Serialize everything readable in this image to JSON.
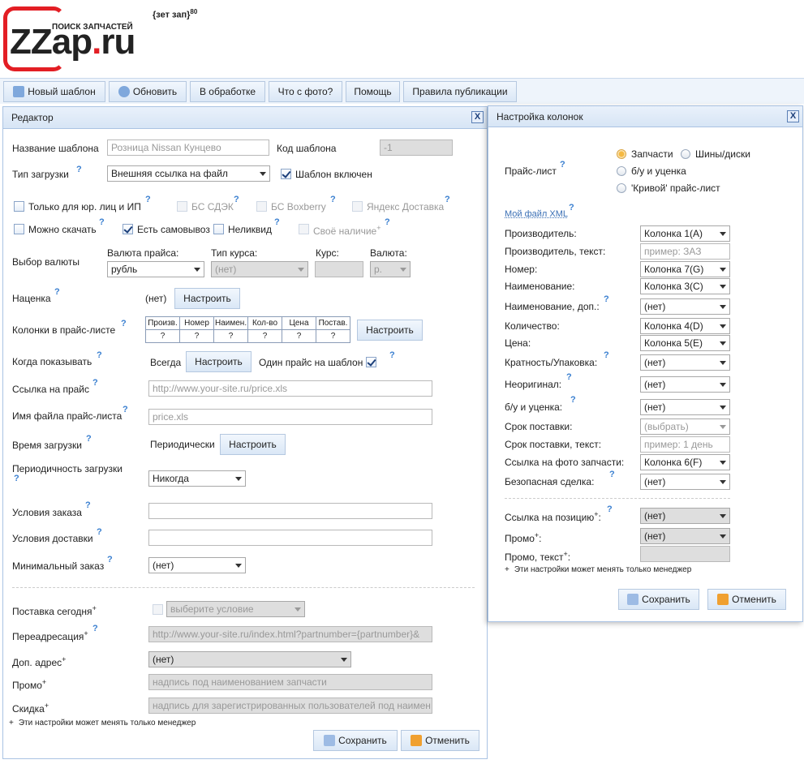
{
  "logo": {
    "main_z": "ZZ",
    "main_rest": "ap",
    "dot": ".",
    "domain": "ru",
    "tagline": "ПОИСК ЗАПЧАСТЕЙ",
    "badge": "{зет зап}",
    "badge_sup": "80"
  },
  "toolbar": {
    "new": "Новый шаблон",
    "refresh": "Обновить",
    "processing": "В обработке",
    "photo": "Что с фото?",
    "help": "Помощь",
    "rules": "Правила публикации"
  },
  "editor": {
    "title": "Редактор",
    "close": "X",
    "name_label": "Название шаблона",
    "name_placeholder": "Розница Nissan Кунцево",
    "code_label": "Код шаблона",
    "code_value": "-1",
    "load_type_label": "Тип загрузки",
    "load_type_value": "Внешняя ссылка на файл",
    "enabled_label": "Шаблон включен",
    "legal_only": "Только для юр. лиц и ИП",
    "cdek": "БС СДЭК",
    "boxberry": "БС Boxberry",
    "yandex": "Яндекс Доставка",
    "downloadable": "Можно скачать",
    "pickup": "Есть самовывоз",
    "illiquid": "Неликвид",
    "own_stock": "Своё наличие",
    "currency_label": "Выбор валюты",
    "price_currency_label": "Валюта прайса:",
    "price_currency_value": "рубль",
    "rate_type_label": "Тип курса:",
    "rate_type_value": "(нет)",
    "rate_label": "Курс:",
    "currency2_label": "Валюта:",
    "currency2_value": "р.",
    "markup_label": "Наценка",
    "markup_value": "(нет)",
    "setup": "Настроить",
    "columns_label": "Колонки в прайс-листе",
    "columns_headers": [
      "Произв.",
      "Номер",
      "Наимен.",
      "Кол-во",
      "Цена",
      "Постав."
    ],
    "columns_values": [
      "?",
      "?",
      "?",
      "?",
      "?",
      "?"
    ],
    "when_show_label": "Когда показывать",
    "when_show_value": "Всегда",
    "one_price_label": "Один прайс на шаблон",
    "price_link_label": "Ссылка на прайс",
    "price_link_placeholder": "http://www.your-site.ru/price.xls",
    "file_name_label": "Имя файла прайс-листа",
    "file_name_placeholder": "price.xls",
    "load_time_label": "Время загрузки",
    "load_time_value": "Периодически",
    "periodicity_label": "Периодичность загрузки",
    "periodicity_value": "Никогда",
    "order_terms_label": "Условия заказа",
    "delivery_terms_label": "Условия доставки",
    "min_order_label": "Минимальный заказ",
    "min_order_value": "(нет)",
    "today_label": "Поставка сегодня",
    "today_placeholder": "выберите условие",
    "redirect_label": "Переадресация",
    "redirect_placeholder": "http://www.your-site.ru/index.html?partnumber={partnumber}&",
    "extra_addr_label": "Доп. адрес",
    "extra_addr_value": "(нет)",
    "promo_label": "Промо",
    "promo_placeholder": "надпись под наименованием запчасти",
    "discount_label": "Скидка",
    "discount_placeholder": "надпись для зарегистрированных пользователей под наимен",
    "note": "Эти настройки может менять только менеджер",
    "plus": "+",
    "save": "Сохранить",
    "cancel": "Отменить",
    "q": "?"
  },
  "columns": {
    "title": "Настройка колонок",
    "close": "X",
    "pricelist_label": "Прайс-лист",
    "radio_parts": "Запчасти",
    "radio_tires": "Шины/диски",
    "radio_used": "б/у и уценка",
    "radio_crooked": "'Кривой' прайс-лист",
    "my_xml": "Мой файл XML",
    "rows": [
      {
        "label": "Производитель:",
        "value": "Колонка 1(A)"
      },
      {
        "label": "Производитель, текст:",
        "value": "пример: ЗАЗ"
      },
      {
        "label": "Номер:",
        "value": "Колонка 7(G)"
      },
      {
        "label": "Наименование:",
        "value": "Колонка 3(C)"
      },
      {
        "label": "Наименование, доп.:",
        "value": "(нет)"
      },
      {
        "label": "Количество:",
        "value": "Колонка 4(D)"
      },
      {
        "label": "Цена:",
        "value": "Колонка 5(E)"
      },
      {
        "label": "Кратность/Упаковка:",
        "value": "(нет)"
      },
      {
        "label": "Неоригинал:",
        "value": "(нет)"
      },
      {
        "label": "б/у и уценка:",
        "value": "(нет)"
      },
      {
        "label": "Срок поставки:",
        "value": "(выбрать)"
      },
      {
        "label": "Срок поставки, текст:",
        "value": "пример: 1 день"
      },
      {
        "label": "Ссылка на фото запчасти:",
        "value": "Колонка 6(F)"
      },
      {
        "label": "Безопасная сделка:",
        "value": "(нет)"
      }
    ],
    "pos_link_label": "Ссылка на позицию",
    "pos_link_value": "(нет)",
    "promo_label": "Промо",
    "promo_value": "(нет)",
    "promo_text_label": "Промо, текст",
    "colon": ":",
    "note": "Эти настройки может менять только менеджер",
    "save": "Сохранить",
    "cancel": "Отменить"
  }
}
